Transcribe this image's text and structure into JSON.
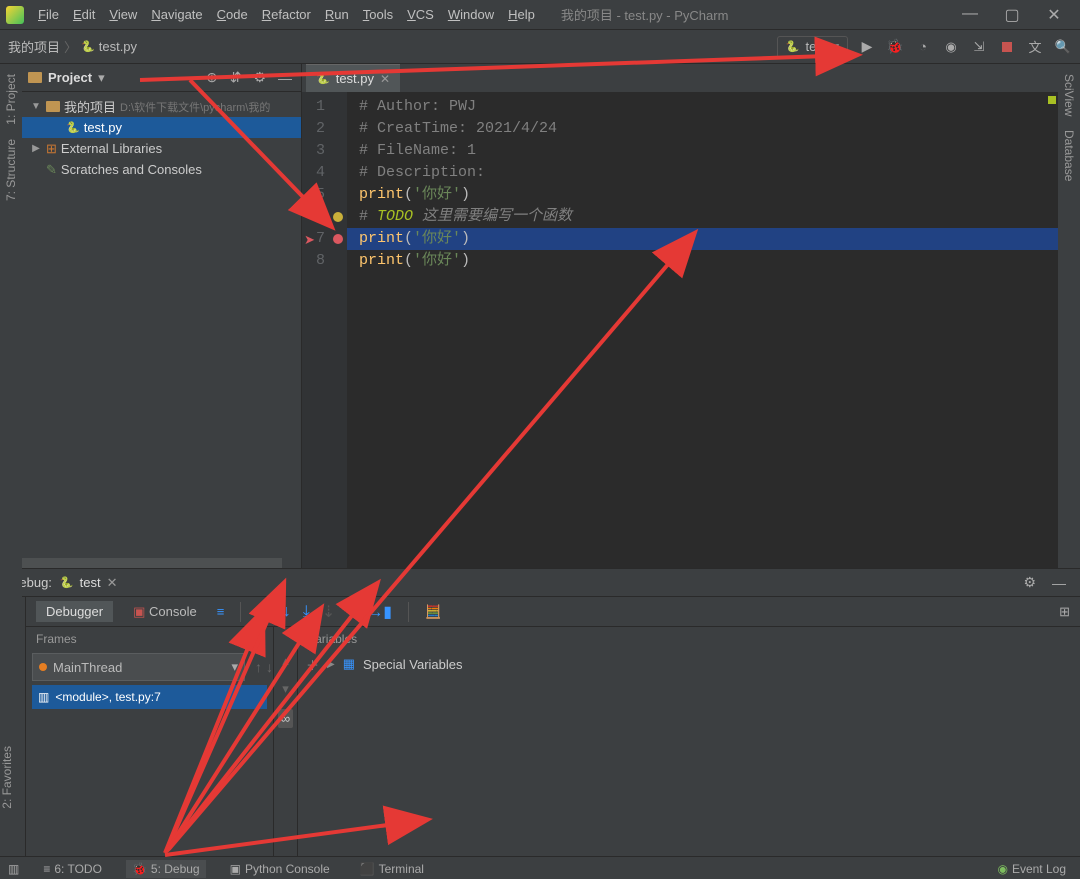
{
  "menus": [
    "File",
    "Edit",
    "View",
    "Navigate",
    "Code",
    "Refactor",
    "Run",
    "Tools",
    "VCS",
    "Window",
    "Help"
  ],
  "menus_mn": [
    "F",
    "E",
    "V",
    "N",
    "C",
    "R",
    "R",
    "T",
    "V",
    "W",
    "H"
  ],
  "title": "我的项目 - test.py - PyCharm",
  "crumbs": {
    "project": "我的项目",
    "file": "test.py"
  },
  "runcfg": {
    "name": "test"
  },
  "project_panel": {
    "title": "Project",
    "items": [
      {
        "ind": 0,
        "arrow": "▼",
        "type": "folder",
        "label": "我的项目",
        "hint": " D:\\软件下载文件\\pycharm\\我的"
      },
      {
        "ind": 1,
        "arrow": "",
        "type": "py",
        "label": "test.py",
        "sel": true
      },
      {
        "ind": 0,
        "arrow": "▶",
        "type": "lib",
        "label": "External Libraries"
      },
      {
        "ind": 0,
        "arrow": "",
        "type": "scratch",
        "label": "Scratches and Consoles"
      }
    ]
  },
  "tab": {
    "label": "test.py"
  },
  "code_lines": [
    {
      "n": 1,
      "comment": "# Author: PWJ"
    },
    {
      "n": 2,
      "comment": "# CreatTime: 2021/4/24"
    },
    {
      "n": 3,
      "comment": "# FileName: 1"
    },
    {
      "n": 4,
      "comment": "# Description:"
    },
    {
      "n": 5,
      "print": true,
      "str": "'你好'"
    },
    {
      "n": 6,
      "todo": "TODO",
      "todotxt": " 这里需要编写一个函数"
    },
    {
      "n": 7,
      "print": true,
      "str": "'你好'",
      "cur": true,
      "bp": true
    },
    {
      "n": 8,
      "print": true,
      "str": "'你好'"
    }
  ],
  "debug": {
    "label": "Debug:",
    "tab": "test",
    "debugger_tab": "Debugger",
    "console_tab": "Console",
    "frames_label": "Frames",
    "variables_label": "Variables",
    "thread": "MainThread",
    "frame": "<module>, test.py:7",
    "special": "Special Variables"
  },
  "status": {
    "todo": "6: TODO",
    "debug": "5: Debug",
    "pyconsole": "Python Console",
    "terminal": "Terminal",
    "eventlog": "Event Log"
  },
  "side": {
    "project": "1: Project",
    "structure": "7: Structure",
    "favorites": "2: Favorites",
    "sciview": "SciView",
    "database": "Database"
  }
}
